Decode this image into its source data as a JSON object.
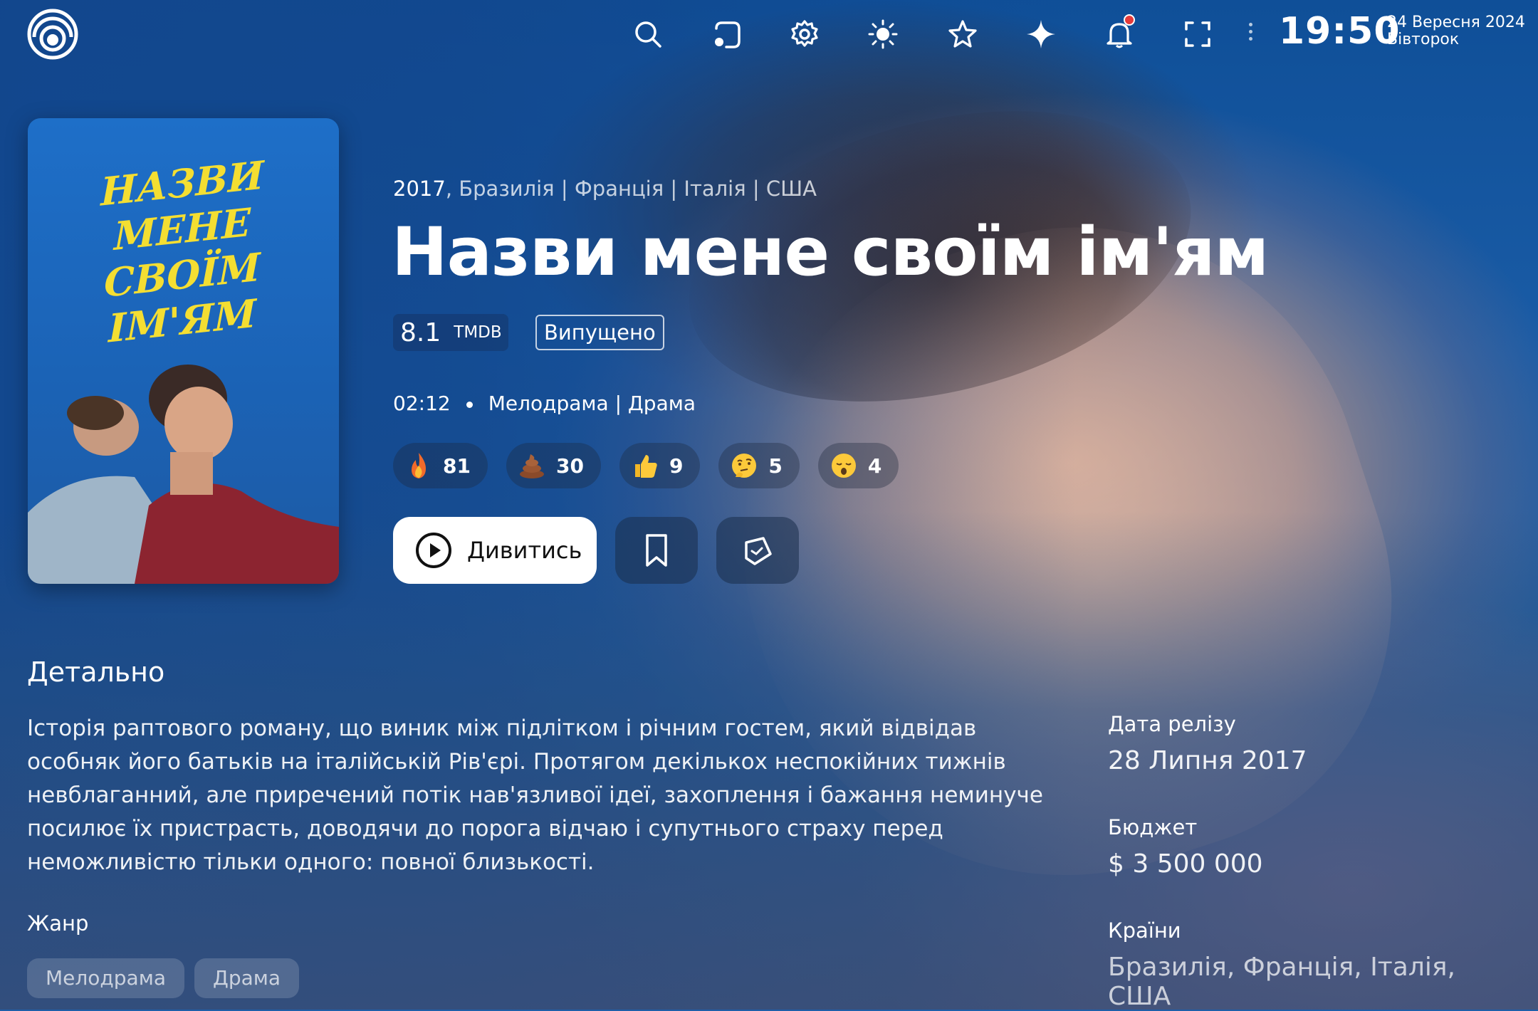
{
  "header": {
    "time": "19:50",
    "date": "24 Вересня 2024",
    "weekday": "Вівторок"
  },
  "toolbar_icons": [
    "search-icon",
    "device-icon",
    "gear-icon",
    "brightness-icon",
    "star-icon",
    "sparkle-icon",
    "bell-icon",
    "fullscreen-icon"
  ],
  "poster": {
    "title_lines": [
      "НАЗВИ МЕНЕ",
      "СВОЇМ",
      "ІМ'ЯМ"
    ]
  },
  "movie": {
    "year": "2017",
    "countries_line": ", Бразилія | Франція | Італія | США",
    "title": "Назви мене своїм ім'ям",
    "rating": "8.1",
    "rating_source": "TMDB",
    "status": "Випущено",
    "runtime": "02:12",
    "genres_line": "Мелодрама | Драма",
    "reactions": [
      {
        "icon": "fire",
        "count": "81"
      },
      {
        "icon": "poop",
        "count": "30"
      },
      {
        "icon": "thumbs-up",
        "count": "9"
      },
      {
        "icon": "thinking",
        "count": "5"
      },
      {
        "icon": "sleepy",
        "count": "4"
      }
    ],
    "watch_label": "Дивитись"
  },
  "details": {
    "heading": "Детально",
    "description": "Історія раптового роману, що виник між підлітком і річним гостем, який відвідав особняк його батьків на італійській Рів'єрі. Протягом декількох неспокійних тижнів невблаганний, але приречений потік нав'язливої ідеї, захоплення і бажання неминуче посилює їх пристрасть, доводячи до порога відчаю і супутнього страху перед неможливістю тільки одного: повної близькості.",
    "genre_heading": "Жанр",
    "genres": [
      "Мелодрама",
      "Драма"
    ],
    "release_label": "Дата релізу",
    "release_value": "28 Липня 2017",
    "budget_label": "Бюджет",
    "budget_value": "$ 3 500 000",
    "countries_label": "Країни",
    "countries_value": "Бразилія, Франція, Італія, США"
  },
  "colors": {
    "background": "#1f5ea8",
    "poster_title": "#f4de32",
    "notification": "#e53a3a"
  }
}
